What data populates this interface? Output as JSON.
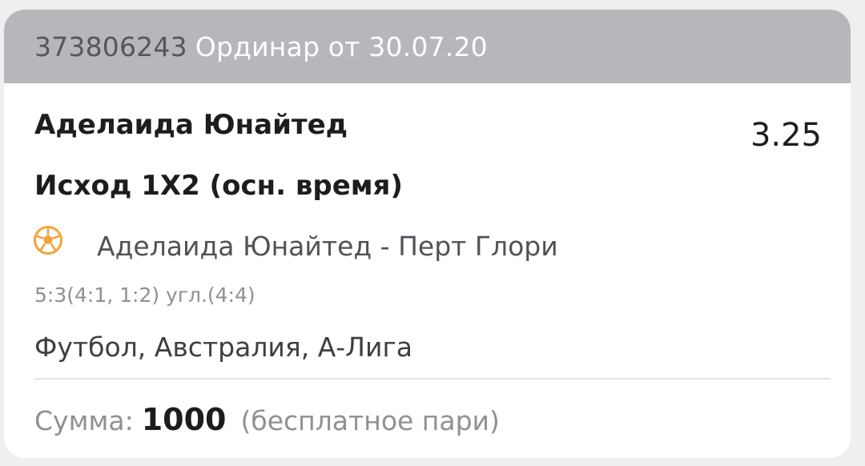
{
  "header": {
    "bet_id": "373806243",
    "bet_type": "Ординар от 30.07.20"
  },
  "selection": {
    "team": "Аделаида Юнайтед",
    "odds": "3.25",
    "market": "Исход 1X2 (осн. время)"
  },
  "event": {
    "sport_icon": "soccer-ball-icon",
    "match": "Аделаида Юнайтед - Перт Глори",
    "score": "5:3(4:1, 1:2) угл.(4:4)",
    "league": "Футбол, Австралия, А-Лига"
  },
  "footer": {
    "sum_label": "Сумма:",
    "amount": "1000",
    "note": "(бесплатное пари)"
  },
  "colors": {
    "header_bg": "#b5b7bb",
    "ball_orange": "#f3a23a"
  }
}
